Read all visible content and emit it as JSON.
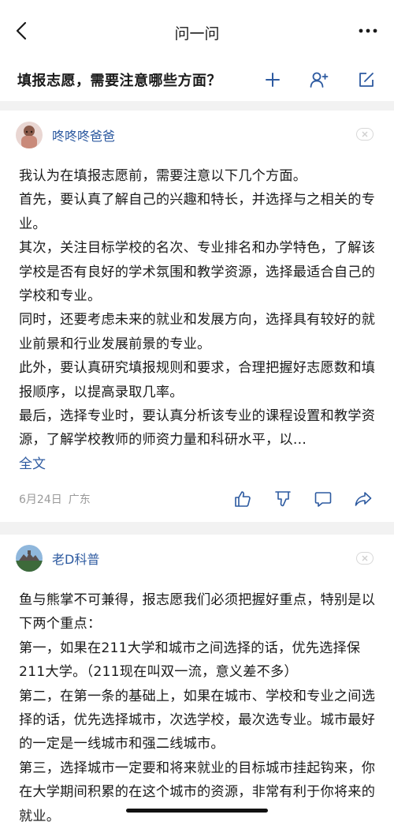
{
  "nav": {
    "title": "问一问"
  },
  "question": {
    "title": "填报志愿，需要注意哪些方面？"
  },
  "answers": [
    {
      "author": "咚咚咚爸爸",
      "paragraphs": [
        "我认为在填报志愿前，需要注意以下几个方面。",
        "首先，要认真了解自己的兴趣和特长，并选择与之相关的专业。",
        "其次，关注目标学校的名次、专业排名和办学特色，了解该学校是否有良好的学术氛围和教学资源，选择最适合自己的学校和专业。",
        "同时，还要考虑未来的就业和发展方向，选择具有较好的就业前景和行业发展前景的专业。",
        "此外，要认真研究填报规则和要求，合理把握好志愿数和填报顺序，以提高录取几率。",
        "最后，选择专业时，要认真分析该专业的课程设置和教学资源，了解学校教师的师资力量和科研水平，以…"
      ],
      "full_text_label": "全文",
      "date": "6月24日",
      "location": "广东"
    },
    {
      "author": "老D科普",
      "paragraphs": [
        "鱼与熊掌不可兼得，报志愿我们必须把握好重点，特别是以下两个重点：",
        "第一，如果在211大学和城市之间选择的话，优先选择保211大学。（211现在叫双一流，意义差不多）",
        "第二，在第一条的基础上，如果在城市、学校和专业之间选择的话，优先选择城市，次选学校，最次选专业。城市最好的一定是一线城市和强二线城市。",
        "第三，选择城市一定要和将来就业的目标城市挂起钩来，你在大学期间积累的在这个城市的资源，非常有利于你将来的就业。"
      ]
    }
  ],
  "colors": {
    "author_name": "#2d5aa0",
    "separator": "#f2f2f2",
    "meta_text": "#9a9a9a"
  }
}
